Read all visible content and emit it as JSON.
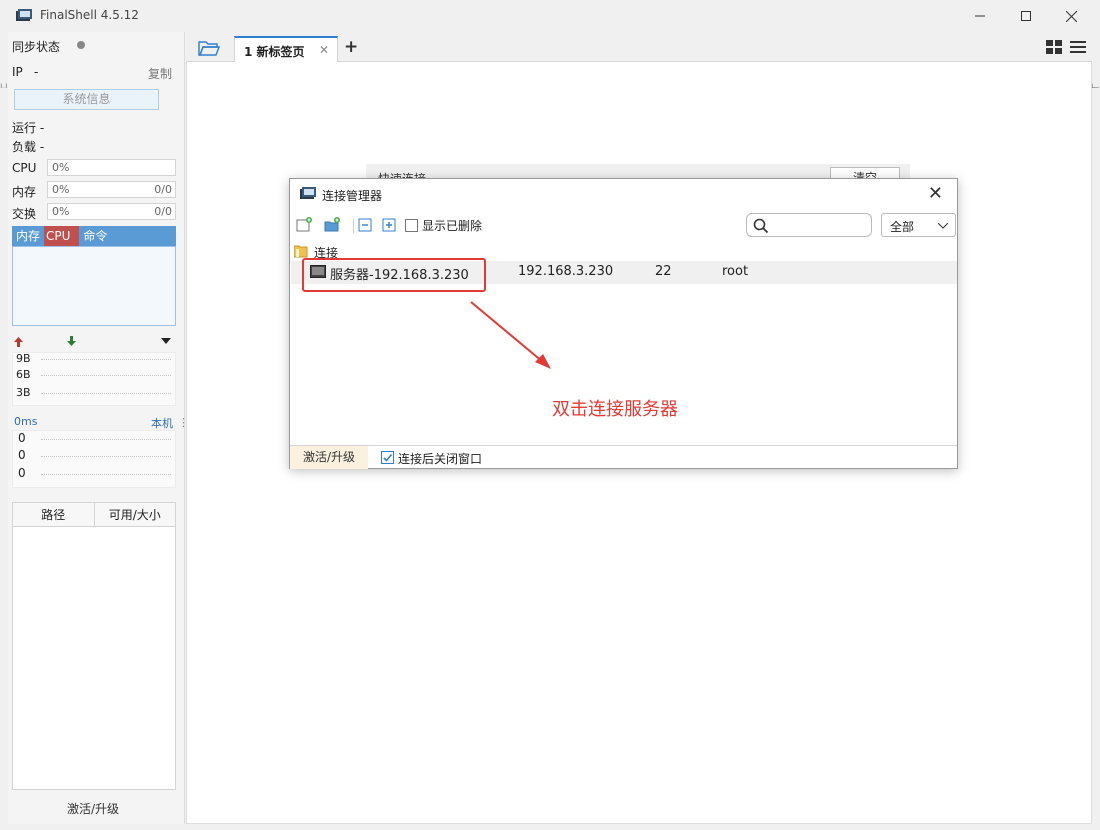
{
  "window": {
    "title": "FinalShell 4.5.12",
    "controls": [
      "minimize",
      "maximize",
      "close"
    ]
  },
  "sidebar": {
    "sync_status": "同步状态",
    "ip_label": "IP",
    "ip_value": "-",
    "copy": "复制",
    "sysinfo_button": "系统信息",
    "run_label": "运行 -",
    "load_label": "负载 -",
    "cpu_label": "CPU",
    "cpu_value": "0%",
    "mem_label": "内存",
    "mem_value": "0%",
    "mem_size": "0/0",
    "swap_label": "交换",
    "swap_value": "0%",
    "swap_size": "0/0",
    "proc_tabs": [
      "内存",
      "CPU",
      "命令"
    ],
    "net_ticks": [
      "9B",
      "6B",
      "3B"
    ],
    "ping_label": "0ms",
    "ping_host": "本机",
    "ping_ticks": [
      "0",
      "0",
      "0"
    ],
    "disk_headers": [
      "路径",
      "可用/大小"
    ],
    "activate": "激活/升级"
  },
  "tabs": {
    "items": [
      {
        "label": "1 新标签页",
        "active": true
      }
    ],
    "add": "+"
  },
  "background_panel": {
    "quick_connect": "快速连接",
    "button": "清空"
  },
  "dialog": {
    "title": "连接管理器",
    "show_deleted": "显示已删除",
    "search_placeholder": "",
    "filter_value": "全部",
    "folder": "连接",
    "connections": [
      {
        "name": "服务器-192.168.3.230",
        "host": "192.168.3.230",
        "port": "22",
        "user": "root"
      }
    ],
    "footer_activate": "激活/升级",
    "close_after_connect": "连接后关闭窗口",
    "close_after_connect_checked": true
  },
  "annotation": {
    "text": "双击连接服务器",
    "color": "#e53935"
  },
  "colors": {
    "accent": "#2f7fd1",
    "annotation_red": "#e53935",
    "proc_tab_blue": "#5b9bd5",
    "proc_tab_active": "#c0504d"
  }
}
